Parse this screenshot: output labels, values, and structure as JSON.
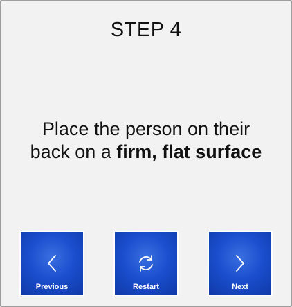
{
  "card": {
    "step_title": "STEP 4",
    "instruction": {
      "line1": "Place the person on their",
      "line2_prefix": "back on a ",
      "line2_emphasis": "firm, flat surface"
    }
  },
  "navigation": {
    "previous": {
      "label": "Previous",
      "icon": "chevron-left-icon"
    },
    "restart": {
      "label": "Restart",
      "icon": "refresh-icon"
    },
    "next": {
      "label": "Next",
      "icon": "chevron-right-icon"
    }
  },
  "colors": {
    "background": "#f2f2f2",
    "border": "#9e9e9e",
    "button_blue": "#1b4fcf",
    "button_text": "#ffffff"
  }
}
